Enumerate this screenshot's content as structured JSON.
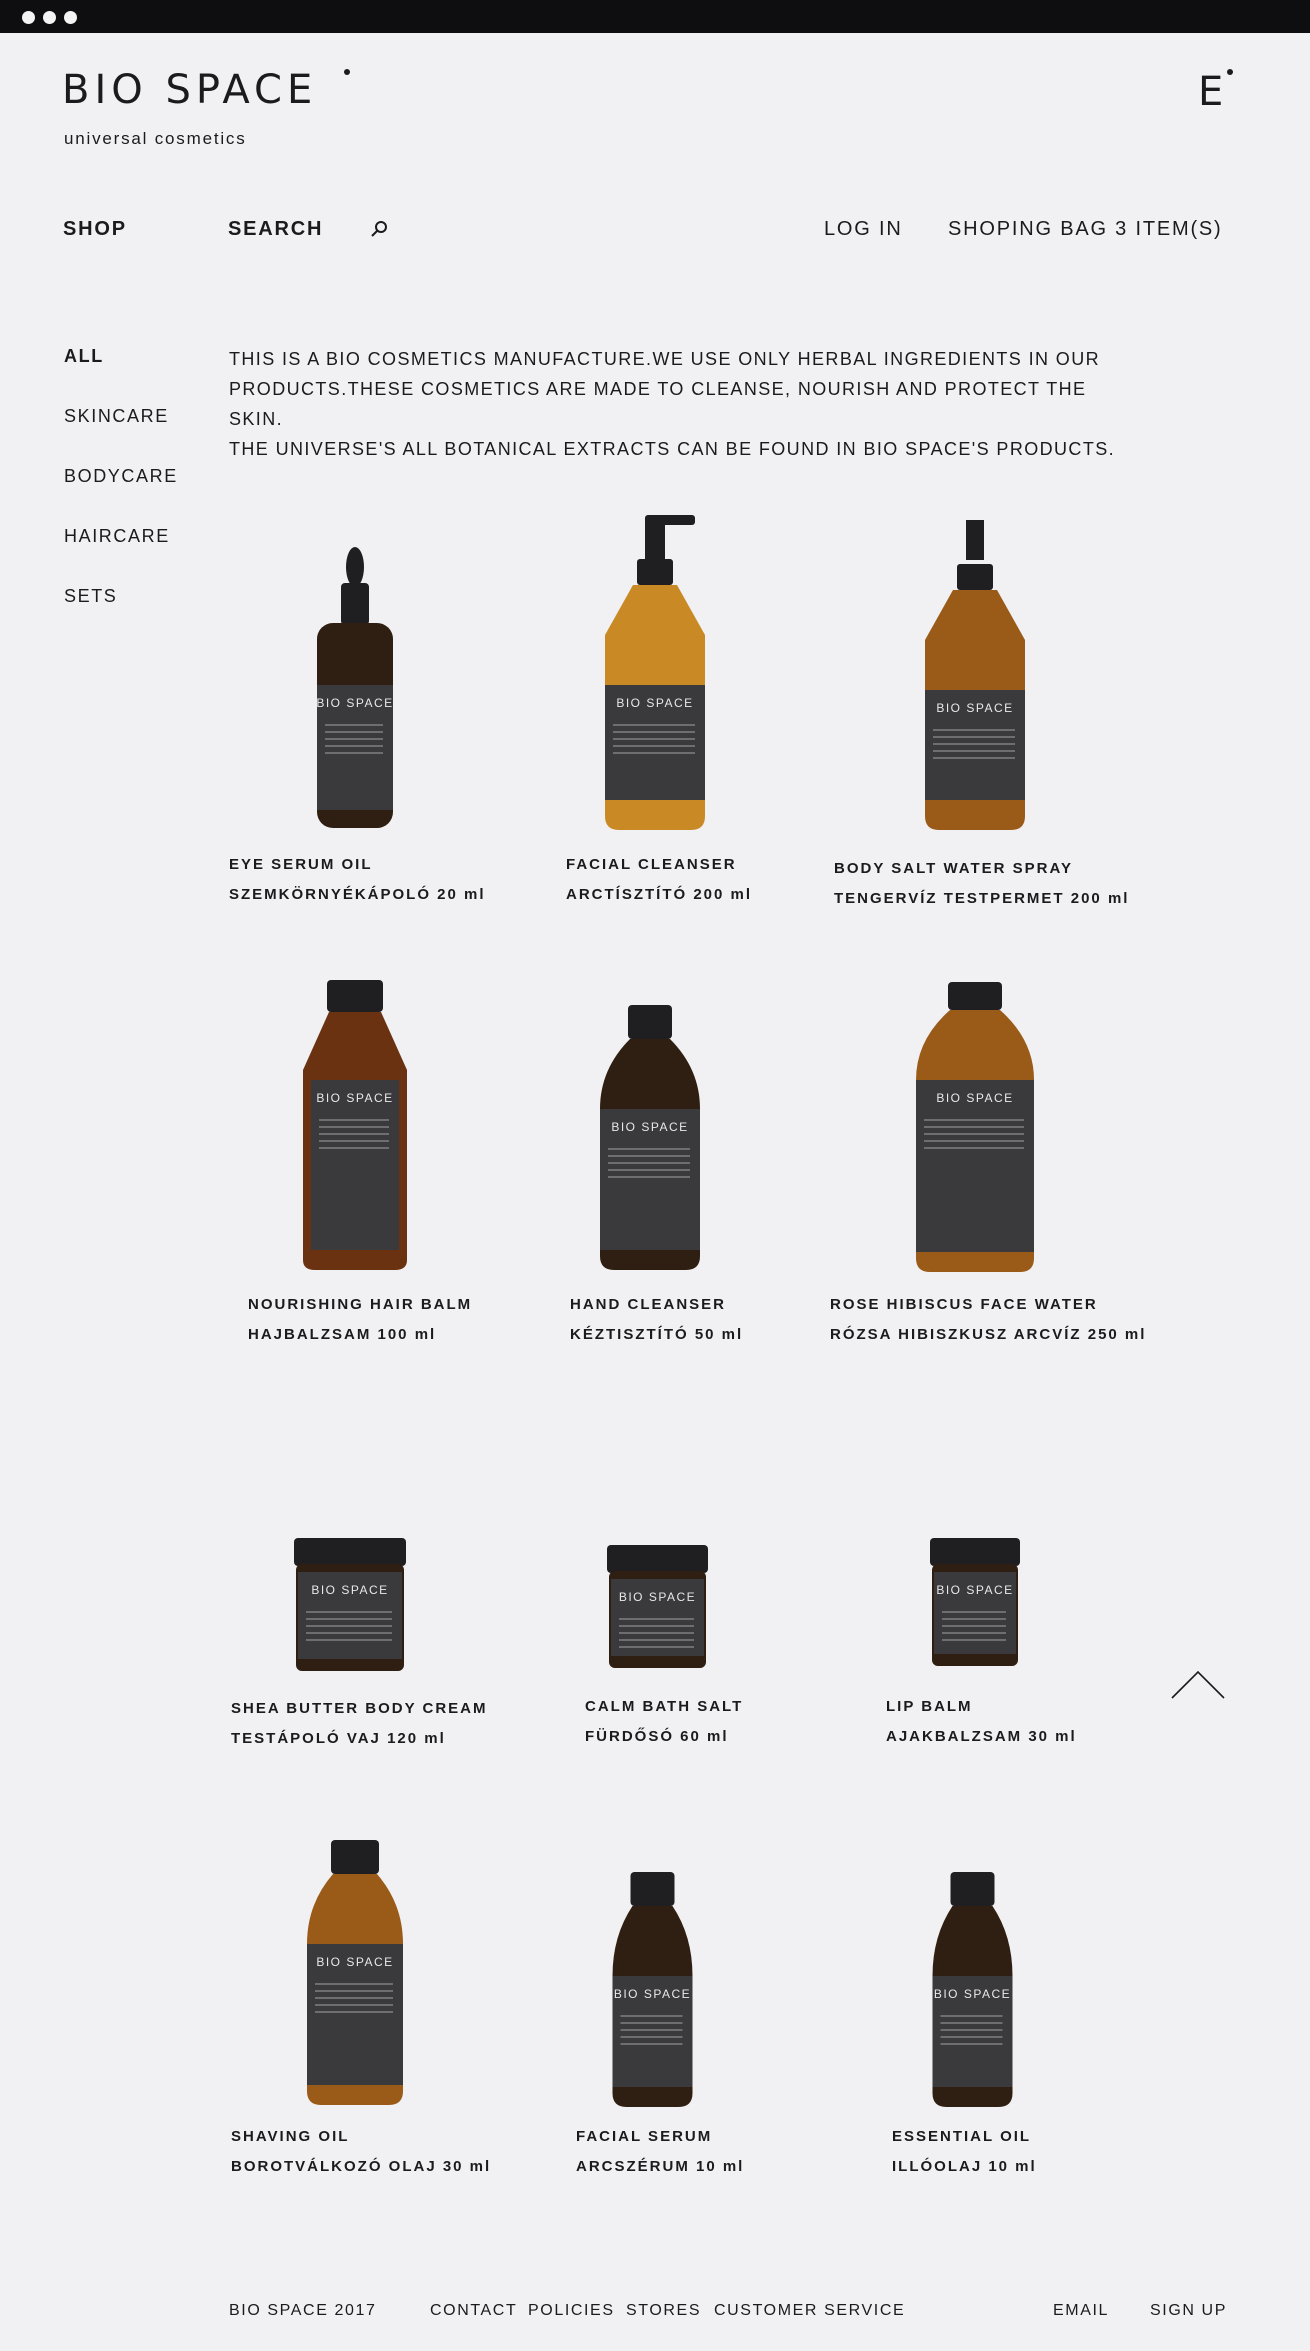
{
  "colors": {
    "background": "#f1f0f2",
    "text": "#1b1b1d",
    "label": "#3a3a3c",
    "amber": "#9a5a18",
    "dark_glass": "#2e1f12",
    "cap": "#1f1f21"
  },
  "brand": {
    "name": "BIO SPACE",
    "tagline": "universal cosmetics",
    "mark": "E"
  },
  "nav": {
    "shop": "SHOP",
    "search": "SEARCH",
    "login": "LOG IN",
    "bag": "SHOPING BAG 3 ITEM(S)"
  },
  "categories": [
    "ALL",
    "SKINCARE",
    "BODYCARE",
    "HAIRCARE",
    "SETS"
  ],
  "intro": {
    "line1": "THIS IS A BIO COSMETICS MANUFACTURE.WE USE ONLY HERBAL INGREDIENTS IN OUR",
    "line2": "PRODUCTS.THESE COSMETICS ARE MADE TO CLEANSE, NOURISH AND PROTECT THE SKIN.",
    "line3": "THE UNIVERSE'S ALL BOTANICAL EXTRACTS CAN BE FOUND IN BIO SPACE'S PRODUCTS."
  },
  "products": [
    {
      "name": "EYE SERUM OIL",
      "sub": "SZEMKÖRNYÉKÁPOLÓ  20 ml",
      "kind": "dropper"
    },
    {
      "name": "FACIAL CLEANSER",
      "sub": "ARCTÍSZTÍTÓ   200 ml",
      "kind": "pump"
    },
    {
      "name": "BODY SALT WATER SPRAY",
      "sub": "TENGERVÍZ TESTPERMET  200 ml",
      "kind": "spray"
    },
    {
      "name": "NOURISHING HAIR BALM",
      "sub": "HAJBALZSAM  100 ml",
      "kind": "flask"
    },
    {
      "name": "HAND CLEANSER",
      "sub": "KÉZTISZTÍTÓ  50 ml",
      "kind": "small"
    },
    {
      "name": "ROSE HIBISCUS FACE WATER",
      "sub": "RÓZSA HIBISZKUSZ ARCVÍZ   250 ml",
      "kind": "big"
    },
    {
      "name": "SHEA BUTTER BODY CREAM",
      "sub": "TESTÁPOLÓ VAJ  120 ml",
      "kind": "jar-wide"
    },
    {
      "name": "CALM BATH SALT",
      "sub": "FÜRDŐSÓ  60 ml",
      "kind": "jar"
    },
    {
      "name": "LIP BALM",
      "sub": "AJAKBALZSAM  30 ml",
      "kind": "jar-small"
    },
    {
      "name": "SHAVING OIL",
      "sub": "BOROTVÁLKOZÓ OLAJ  30 ml",
      "kind": "vial"
    },
    {
      "name": "FACIAL SERUM",
      "sub": "ARCSZÉRUM  10 ml",
      "kind": "vial-small"
    },
    {
      "name": "ESSENTIAL OIL",
      "sub": "ILLÓOLAJ  10 ml",
      "kind": "vial-small"
    }
  ],
  "footer": {
    "copyright": "BIO SPACE 2017",
    "contact": "CONTACT",
    "policies": "POLICIES",
    "stores": "STORES",
    "service": "CUSTOMER SERVICE",
    "email": "EMAIL",
    "signup": "SIGN UP"
  },
  "icons": {
    "search": "search-icon",
    "back_to_top": "chevron-up-icon"
  }
}
